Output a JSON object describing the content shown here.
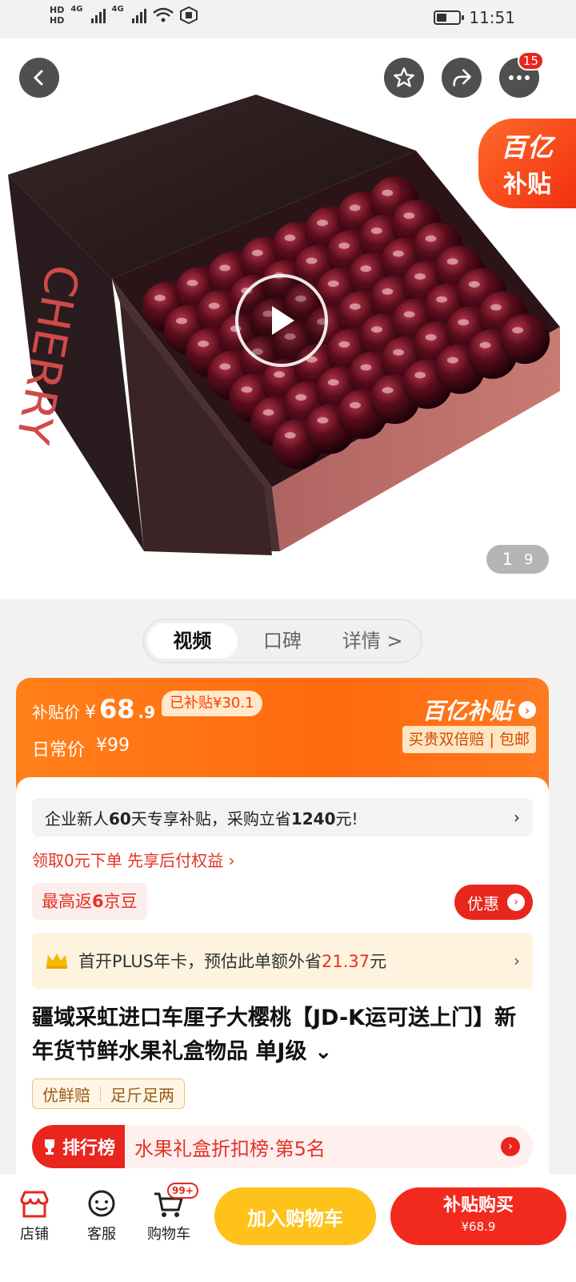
{
  "status_bar": {
    "hd_top": "HD",
    "hd_bottom": "HD",
    "network_1": "4G",
    "network_2": "4G",
    "time": "11:51",
    "battery_level": 0.45
  },
  "header": {
    "cart_count_badge": "15"
  },
  "hero": {
    "subsidy_line1": "百亿",
    "subsidy_line2": "补贴",
    "pager_current": "1",
    "pager_total": "9"
  },
  "tabs": [
    "视频",
    "口碑",
    "详情 >"
  ],
  "price": {
    "subsidy_label": "补贴价",
    "currency": "¥",
    "price_int": "68",
    "price_dec": ".9",
    "already_subsidized": "已补贴¥30.1",
    "daily_label": "日常价",
    "daily_price": "¥99",
    "brand": "百亿补贴",
    "guarantee": "买贵双倍赔 | 包邮"
  },
  "promo": {
    "notice_prefix": "企业新人",
    "notice_days": "60",
    "notice_mid": "天专享补贴，采购立省",
    "notice_amount": "1240",
    "notice_suffix": "元!",
    "pay_later": "领取0元下单 先享后付权益 ›",
    "beans_prefix": "最高返",
    "beans_count": "6",
    "beans_suffix": "京豆",
    "coupon_button": "优惠",
    "plus_prefix": "首开PLUS年卡，预估此单额外省",
    "plus_amount": "21.37",
    "plus_suffix": "元"
  },
  "product": {
    "title": "疆域采虹进口车厘子大樱桃【JD-K运可送上门】新年货节鲜水果礼盒物品 单J级 ⌄",
    "tag_1": "优鲜赔",
    "tag_2": "足斤足两",
    "rank_label": "排行榜",
    "rank_text": "水果礼盒折扣榜·第5名"
  },
  "bottom_bar": {
    "store": "店铺",
    "service": "客服",
    "cart": "购物车",
    "cart_badge": "99+",
    "add_to_cart": "加入购物车",
    "buy_line1": "补贴购买",
    "buy_line2": "¥68.9"
  },
  "colors": {
    "brand_red": "#e8261d",
    "subsidy_orange": "#ff6a0f",
    "add_cart_yellow": "#ffc21a"
  }
}
